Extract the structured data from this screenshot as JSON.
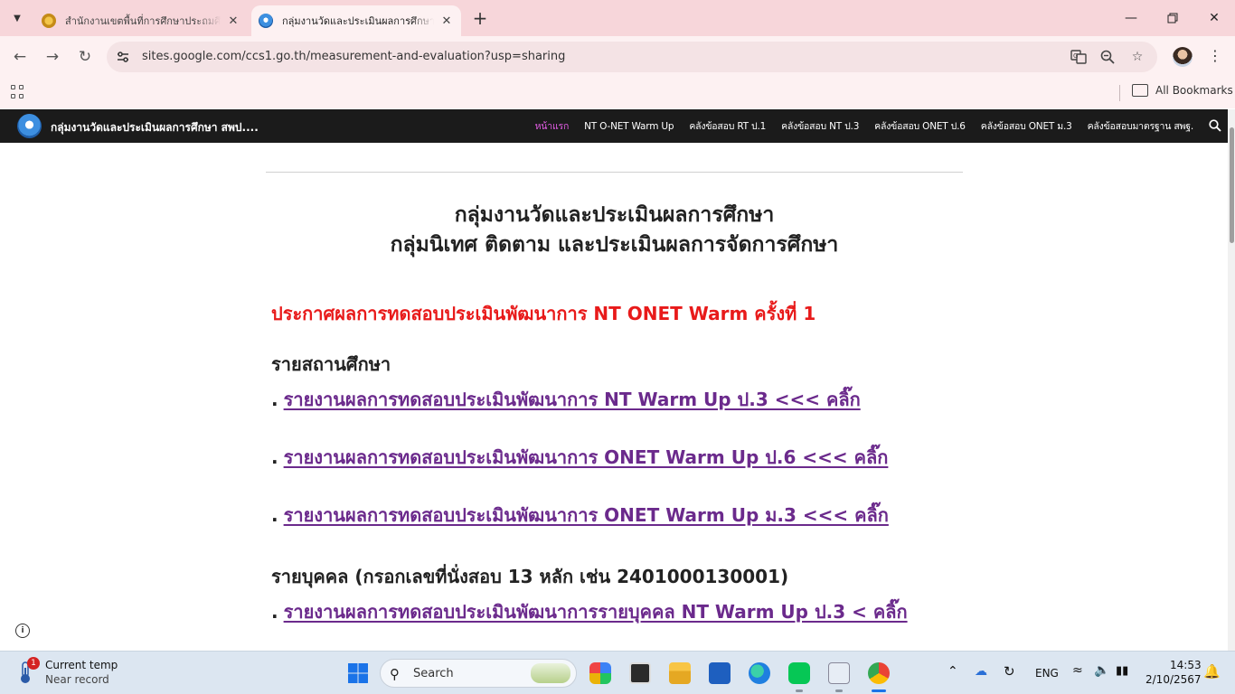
{
  "browser": {
    "tabs": [
      {
        "title": "สำนักงานเขตพื้นที่การศึกษาประถมศึกษา",
        "active": false,
        "icon": "school-seal-icon"
      },
      {
        "title": "กลุ่มงานวัดและประเมินผลการศึกษา สพป.",
        "active": true,
        "icon": "site-logo-icon"
      }
    ],
    "url": "sites.google.com/ccs1.go.th/measurement-and-evaluation?usp=sharing",
    "bookmarks_label": "All Bookmarks"
  },
  "site": {
    "title": "กลุ่มงานวัดและประเมินผลการศึกษา สพป....",
    "nav": [
      {
        "label": "หน้าแรก",
        "current": true
      },
      {
        "label": "NT O-NET Warm Up",
        "current": false
      },
      {
        "label": "คลังข้อสอบ RT ป.1",
        "current": false
      },
      {
        "label": "คลังข้อสอบ NT ป.3",
        "current": false
      },
      {
        "label": "คลังข้อสอบ ONET ป.6",
        "current": false
      },
      {
        "label": "คลังข้อสอบ ONET ม.3",
        "current": false
      },
      {
        "label": "คลังข้อสอบมาตรฐาน สพฐ.",
        "current": false
      }
    ]
  },
  "page": {
    "heading_line1": "กลุ่มงานวัดและประเมินผลการศึกษา",
    "heading_line2": "กลุ่มนิเทศ ติดตาม และประเมินผลการจัดการศึกษา",
    "announcement": "ประกาศผลการทดสอบประเมินพัฒนาการ NT ONET Warm ครั้งที่ 1",
    "section_school": "รายสถานศึกษา",
    "school_links": [
      "รายงานผลการทดสอบประเมินพัฒนาการ NT Warm Up ป.3 <<< คลิ๊ก",
      "รายงานผลการทดสอบประเมินพัฒนาการ ONET Warm Up ป.6 <<< คลิ๊ก",
      "รายงานผลการทดสอบประเมินพัฒนาการ ONET Warm Up ม.3 <<< คลิ๊ก"
    ],
    "section_individual": "รายบุคคล (กรอกเลขที่นั่งสอบ 13 หลัก เช่น 2401000130001)",
    "individual_links": [
      "รายงานผลการทดสอบประเมินพัฒนาการรายบุคคล NT Warm Up ป.3 < คลิ๊ก"
    ],
    "bullet": "."
  },
  "taskbar": {
    "weather_title": "Current temp",
    "weather_sub": "Near record",
    "weather_badge": "1",
    "search_placeholder": "Search",
    "language": "ENG",
    "time": "14:53",
    "date": "2/10/2567"
  },
  "colors": {
    "tabstrip": "#f7d6da",
    "toolbar": "#fdf1f2",
    "site_header": "#1b1b1b",
    "nav_current": "#e45de6",
    "announcement": "#e81a1a",
    "link": "#6b2a8c",
    "taskbar": "#dce6f1"
  }
}
